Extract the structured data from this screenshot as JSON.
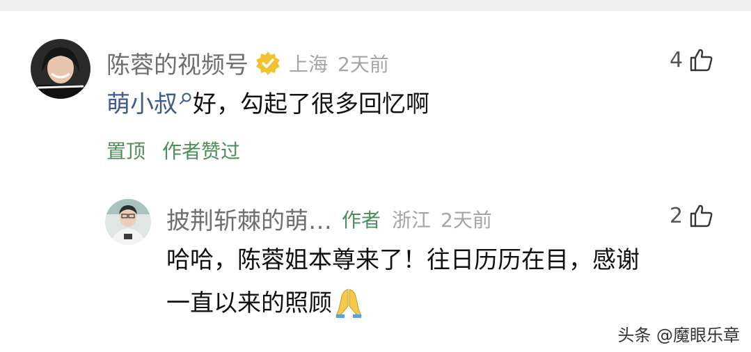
{
  "comment": {
    "author": "陈蓉的视频号",
    "location": "上海",
    "time": "2天前",
    "likes": "4",
    "mention": "萌小叔",
    "text": "好，勾起了很多回忆啊",
    "tag_pinned": "置顶",
    "tag_author_liked": "作者赞过"
  },
  "reply": {
    "author": "披荆斩棘的萌…",
    "author_tag": "作者",
    "location": "浙江",
    "time": "2天前",
    "likes": "2",
    "line1": "哈哈，陈蓉姐本尊来了！往日历历在目，感谢",
    "line2": "一直以来的照顾"
  },
  "watermark": "头条 @魔眼乐章",
  "colors": {
    "author_green": "#4f8d5a",
    "mention_blue": "#3e5b8f",
    "verified_gold": "#f2c230"
  },
  "icons": {
    "verified": "verified-badge-icon",
    "like": "thumbs-up-icon",
    "mention_search": "search-icon",
    "emoji": "folded-hands-emoji"
  }
}
